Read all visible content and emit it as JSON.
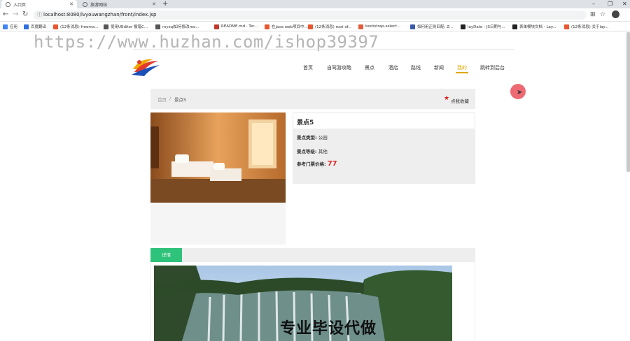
{
  "browser": {
    "tabs": [
      {
        "label": "入口页",
        "active": true
      },
      {
        "label": "旅游网站",
        "active": false
      }
    ],
    "url": "localhost:8080/lvyouwangzhan/front/index.jsp",
    "bookmarks": [
      {
        "label": "应用",
        "color": "#4285f4"
      },
      {
        "label": "百度翻译",
        "color": "#2f6fe0"
      },
      {
        "label": "(12条消息) freema...",
        "color": "#e8572f"
      },
      {
        "label": "使用UEditor 报错C...",
        "color": "#555555"
      },
      {
        "label": "mysql如何修改roo...",
        "color": "#555555"
      },
      {
        "label": "README.md · Ter...",
        "color": "#c0392b"
      },
      {
        "label": "在java web项目中...",
        "color": "#e8572f"
      },
      {
        "label": "(12条消息) root of...",
        "color": "#e8572f"
      },
      {
        "label": "bootstrap-select...",
        "color": "#e25b3a"
      },
      {
        "label": "如何用正则匹配: Z...",
        "color": "#3b5ba9"
      },
      {
        "label": "layDate - JS日期与...",
        "color": "#222222"
      },
      {
        "label": "表单模块文档 - Lay...",
        "color": "#222222"
      },
      {
        "label": "(12条消息) 关于lay...",
        "color": "#e8572f"
      }
    ]
  },
  "watermark": "https://www.huzhan.com/ishop39397",
  "site": {
    "nav": [
      {
        "label": "首页",
        "active": false
      },
      {
        "label": "自驾游攻略",
        "active": false
      },
      {
        "label": "景点",
        "active": false
      },
      {
        "label": "酒店",
        "active": false
      },
      {
        "label": "路线",
        "active": false
      },
      {
        "label": "新闻",
        "active": false
      },
      {
        "label": "我的",
        "active": true
      },
      {
        "label": "跳转到后台",
        "active": false
      }
    ]
  },
  "breadcrumb": {
    "home": "首页",
    "sep": "/",
    "current": "景点5"
  },
  "favorite_label": "点我收藏",
  "spot": {
    "title": "景点5",
    "type_label": "景点类型:",
    "type_value": "公园",
    "level_label": "景点等级:",
    "level_value": "其他",
    "price_label": "参考门票价格:",
    "price_value": "77"
  },
  "detail_tab": "详情",
  "detail_overlay": "专业毕设代做",
  "colors": {
    "accent_green": "#2fc27a",
    "price_red": "#e02020",
    "nav_active": "#e0a600"
  }
}
